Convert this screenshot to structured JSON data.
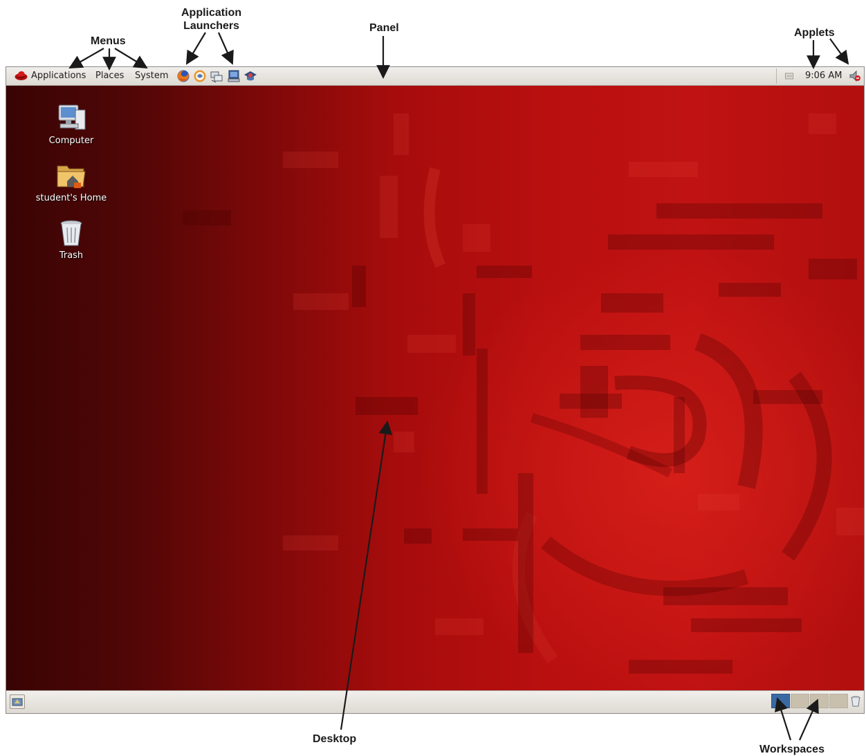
{
  "annotations": {
    "menus": "Menus",
    "app_launchers_line1": "Application",
    "app_launchers_line2": "Launchers",
    "panel": "Panel",
    "applets": "Applets",
    "desktop": "Desktop",
    "workspaces": "Workspaces"
  },
  "top_panel": {
    "menus": [
      {
        "label": "Applications",
        "icon": "redhat-logo-icon"
      },
      {
        "label": "Places"
      },
      {
        "label": "System"
      }
    ],
    "launchers": [
      "firefox-icon",
      "evolution-icon",
      "network-icon",
      "update-icon",
      "help-icon"
    ],
    "clock": "9:06 AM",
    "tray_icons": [
      "network-status-icon",
      "volume-icon"
    ]
  },
  "desktop": {
    "icons": [
      {
        "label": "Computer",
        "icon": "computer-icon"
      },
      {
        "label": "student's Home",
        "icon": "home-folder-icon"
      },
      {
        "label": "Trash",
        "icon": "trash-icon"
      }
    ]
  },
  "bottom_panel": {
    "workspaces": [
      {
        "active": true
      },
      {
        "active": false
      },
      {
        "active": false
      },
      {
        "active": false
      }
    ],
    "icons": [
      "show-desktop-icon",
      "trash-applet-icon"
    ]
  },
  "colors": {
    "panel": "#e8e5e0",
    "desktop_dark": "#3a0404",
    "desktop_red": "#c01212",
    "workspace_active": "#3b6aa3",
    "workspace_inactive": "#c9bfad"
  }
}
